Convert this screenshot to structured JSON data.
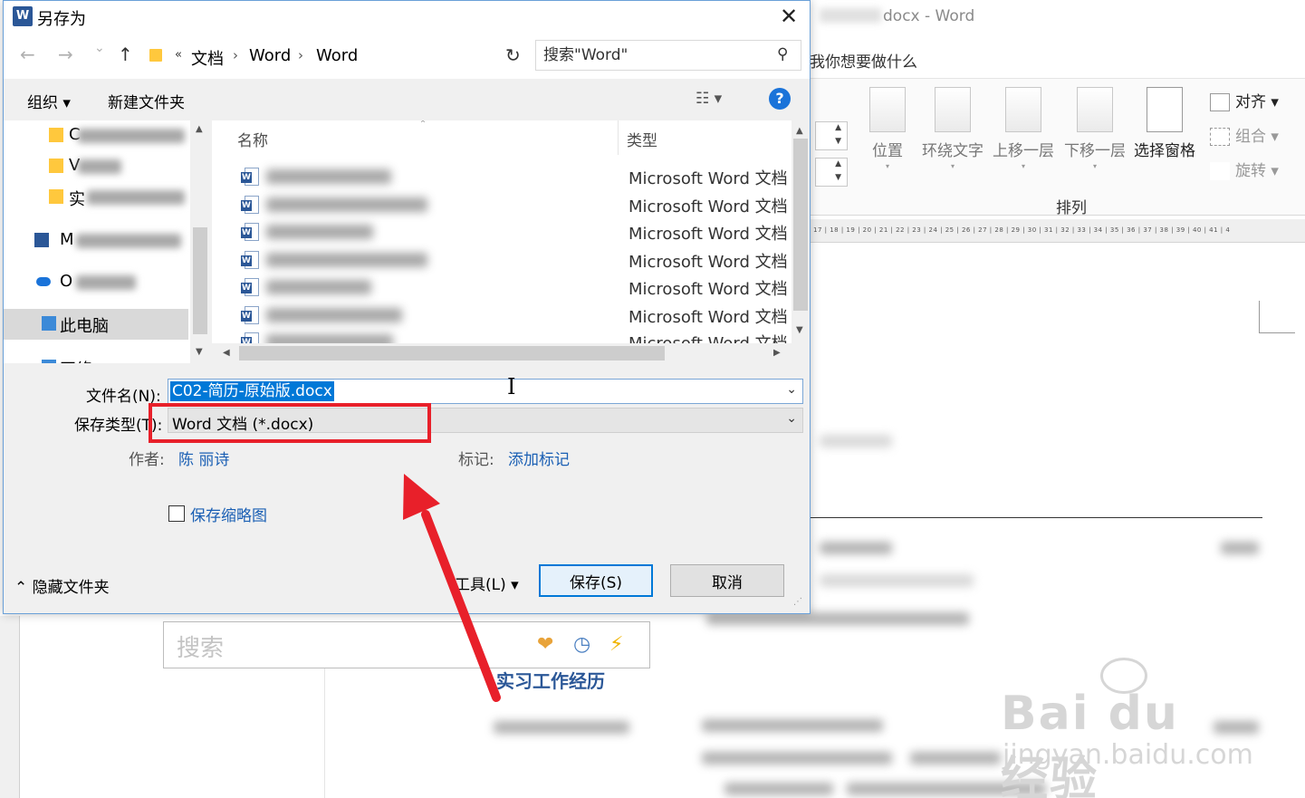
{
  "dialog": {
    "title": "另存为",
    "app_icon": "W",
    "close_glyph": "✕"
  },
  "nav": {
    "back_glyph": "←",
    "forward_glyph": "→",
    "recent_glyph": "⌄",
    "up_glyph": "↑",
    "laquo": "«",
    "breadcrumbs": [
      "文档",
      "Word",
      "Word"
    ],
    "crumb_sep": "›",
    "dropdown_glyph": "⌄",
    "refresh_glyph": "↻",
    "search_placeholder": "搜索\"Word\"",
    "search_glyph": "⚲"
  },
  "toolbar": {
    "organize_label": "组织 ▾",
    "new_folder_label": "新建文件夹",
    "view_glyph": "☷ ▾",
    "help_glyph": "?"
  },
  "nav_pane": {
    "items": [
      {
        "label": "C"
      },
      {
        "label": "V"
      },
      {
        "label": "实"
      },
      {
        "label": "M"
      },
      {
        "label": "O"
      },
      {
        "label": "此电脑"
      },
      {
        "label": "网络"
      }
    ]
  },
  "file_list": {
    "col_name": "名称",
    "col_type": "类型",
    "sort_caret": "˄",
    "file_type_label": "Microsoft Word 文档",
    "rows": 7
  },
  "form": {
    "filename_label": "文件名(N):",
    "filename_value": "C02-简历-原始版.docx",
    "filetype_label": "保存类型(T):",
    "filetype_value": "Word 文档 (*.docx)",
    "author_label": "作者:",
    "author_value": "陈 丽诗",
    "tags_label": "标记:",
    "tags_value": "添加标记",
    "thumbnail_label": "保存缩略图",
    "hide_folders_label": "隐藏文件夹",
    "tools_label": "工具(L)",
    "save_label": "保存(S)",
    "cancel_label": "取消"
  },
  "word_bg": {
    "title": "docx  -  Word",
    "tell_me": "我你想要做什么",
    "ribbon": {
      "position_label": "位置",
      "wrap_label": "环绕文字",
      "forward_label": "上移一层",
      "backward_label": "下移一层",
      "selection_pane_label": "选择窗格",
      "align_label": "对齐 ▾",
      "group_label": "组合 ▾",
      "rotate_label": "旋转 ▾",
      "group_title": "排列"
    },
    "ruler_text": "17 | 18 | 19 | 20 | 21 | 22 | 23 | 24 | 25 | 26 | 27 | 28 | 29 | 30 | 31 | 32 | 33 | 34 | 35 | 36 | 37 | 38 | 39 | 40 | 41 | 4",
    "doc_search_placeholder": "搜索",
    "section_title": "实习工作经历",
    "watermark_main": "Bai du 经验",
    "watermark_sub": "jingyan.baidu.com"
  },
  "colors": {
    "accent": "#0078d7",
    "highlight_box": "#e8202a",
    "link": "#1a5fb4"
  }
}
